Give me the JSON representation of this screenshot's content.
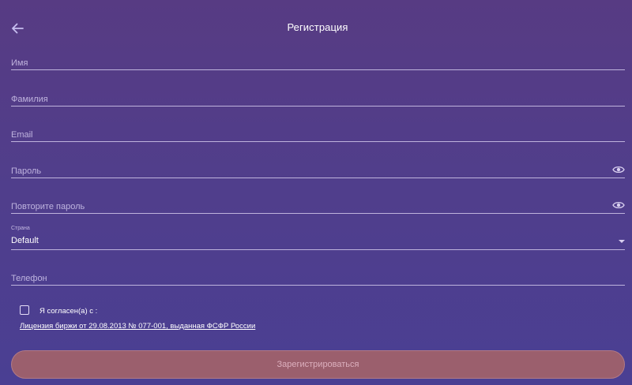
{
  "header": {
    "title": "Регистрация"
  },
  "form": {
    "first_name": {
      "placeholder": "Имя",
      "value": ""
    },
    "last_name": {
      "placeholder": "Фамилия",
      "value": ""
    },
    "email": {
      "placeholder": "Email",
      "value": ""
    },
    "password": {
      "placeholder": "Пароль",
      "value": ""
    },
    "password_repeat": {
      "placeholder": "Повторите пароль",
      "value": ""
    },
    "country": {
      "label": "Страна",
      "value": "Default"
    },
    "phone": {
      "placeholder": "Телефон",
      "value": ""
    },
    "agree": {
      "checked": false,
      "label": "Я согласен(а) с :",
      "link_text": "Лицензия биржи от 29.08.2013 № 077-001, выданная ФСФР России"
    },
    "submit_label": "Зарегистрироваться"
  },
  "icons": {
    "back": "arrow-left-icon",
    "eye": "eye-icon",
    "dropdown": "caret-down-icon"
  },
  "colors": {
    "background_top": "#573b83",
    "background_bottom": "#4a3f93",
    "submit_button": "#9b5f6d"
  }
}
